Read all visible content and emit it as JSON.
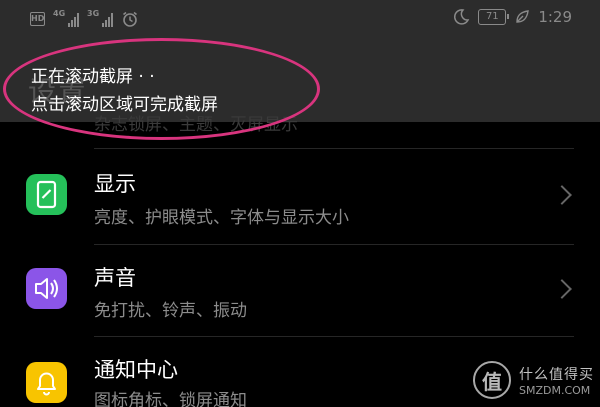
{
  "status_bar": {
    "hd_label": "HD",
    "sim1_label": "4G",
    "sim2_label": "3G",
    "battery": "71",
    "time": "1:29",
    "icons": [
      "hd-icon",
      "signal-icon",
      "signal-icon",
      "alarm-icon",
      "moon-icon",
      "battery-icon",
      "leaf-icon"
    ]
  },
  "notice": {
    "line1": "正在滚动截屏 · ·",
    "line2": "点击滚动区域可完成截屏",
    "ghost_title": "设置",
    "ghost_sub": "杂志锁屏、主题、灭屏显示",
    "highlight_color": "#d8347e"
  },
  "settings": [
    {
      "title": "显示",
      "subtitle": "亮度、护眼模式、字体与显示大小",
      "icon": "display-icon",
      "color": "#25c05a"
    },
    {
      "title": "声音",
      "subtitle": "免打扰、铃声、振动",
      "icon": "speaker-icon",
      "color": "#8b55e8"
    },
    {
      "title": "通知中心",
      "subtitle": "图标角标、锁屏通知",
      "icon": "bell-icon",
      "color": "#f8c400"
    }
  ],
  "watermark": {
    "badge": "值",
    "cn": "什么值得买",
    "url": "SMZDM.COM"
  }
}
